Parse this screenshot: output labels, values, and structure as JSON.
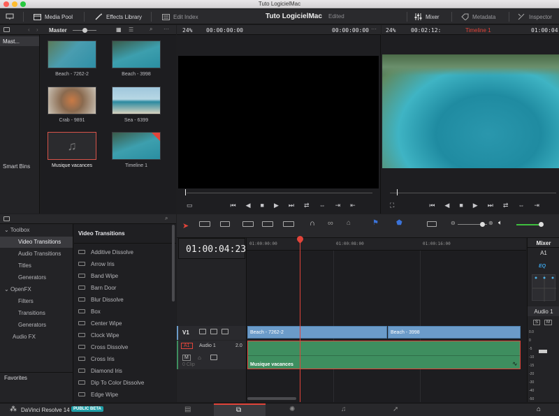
{
  "window": {
    "title": "Tuto LogicielMac"
  },
  "toolbar": {
    "media_pool": "Media Pool",
    "effects_library": "Effects Library",
    "edit_index": "Edit Index",
    "project_title": "Tuto LogicielMac",
    "project_status": "Edited",
    "mixer": "Mixer",
    "metadata": "Metadata",
    "inspector": "Inspector"
  },
  "media_pool": {
    "bin_name": "Master",
    "bins": {
      "master": "Mast...",
      "smart_bins": "Smart Bins"
    },
    "clips": [
      {
        "label": "Beach - 7262-2"
      },
      {
        "label": "Beach - 3998"
      },
      {
        "label": "Crab - 9891"
      },
      {
        "label": "Sea - 6399"
      },
      {
        "label": "Musique vacances"
      },
      {
        "label": "Timeline 1"
      }
    ]
  },
  "source_viewer": {
    "zoom": "24%",
    "timecode_left": "00:00:00:00",
    "timecode_right": "00:00:00:00"
  },
  "timeline_viewer": {
    "zoom": "24%",
    "duration": "00:02:12:",
    "timeline_name": "Timeline 1",
    "timecode": "01:00:04:"
  },
  "effects": {
    "tree": {
      "toolbox": "Toolbox",
      "video_transitions": "Video Transitions",
      "audio_transitions": "Audio Transitions",
      "titles": "Titles",
      "generators": "Generators",
      "openfx": "OpenFX",
      "filters": "Filters",
      "transitions": "Transitions",
      "generators2": "Generators",
      "audio_fx": "Audio FX",
      "favorites": "Favorites"
    },
    "list_title": "Video Transitions",
    "list": [
      "Additive Dissolve",
      "Arrow Iris",
      "Band Wipe",
      "Barn Door",
      "Blur Dissolve",
      "Box",
      "Center Wipe",
      "Clock Wipe",
      "Cross Dissolve",
      "Cross Iris",
      "Diamond Iris",
      "Dip To Color Dissolve",
      "Edge Wipe"
    ]
  },
  "timeline": {
    "timecode": "01:00:04:23",
    "ruler": [
      "01:00:00:00",
      "01:00:08:00",
      "01:00:16:00"
    ],
    "v1": {
      "label": "V1",
      "clips": [
        "Beach - 7262-2",
        "Beach - 3998"
      ]
    },
    "a1": {
      "label": "A1",
      "name": "Audio 1",
      "channels": "2.0",
      "clip_count": "0 Clip",
      "clip": "Musique vacances"
    }
  },
  "mixer": {
    "title": "Mixer",
    "channel": "A1",
    "eq": "EQ",
    "strip_label": "Audio 1",
    "scale": [
      "0.0",
      "0",
      "-5",
      "-10",
      "-15",
      "-20",
      "-30",
      "-40",
      "-50"
    ]
  },
  "status": {
    "app": "DaVinci Resolve 14",
    "badge": "PUBLIC BETA"
  },
  "colors": {
    "accent": "#e2443a",
    "clip_video": "#6b9bc9",
    "clip_audio": "#3e8e5f",
    "badge": "#1e9fa8"
  }
}
